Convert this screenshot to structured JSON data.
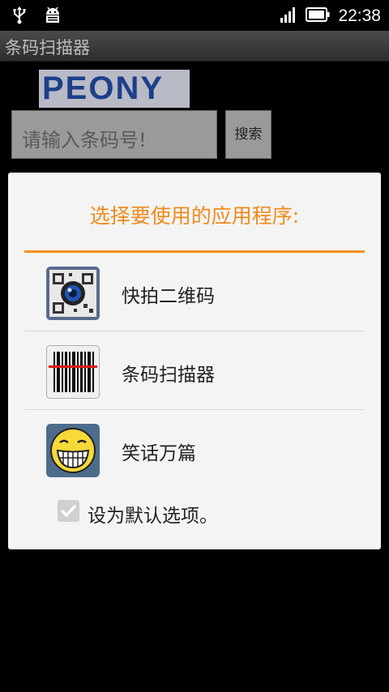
{
  "status_bar": {
    "time": "22:38",
    "icons": [
      "usb-icon",
      "android-debug-icon",
      "signal-icon",
      "battery-icon"
    ]
  },
  "app_title": "条码扫描器",
  "main": {
    "logo_text": "PEONY",
    "search_placeholder": "请输入条码号!",
    "search_button": "搜索"
  },
  "dialog": {
    "title": "选择要使用的应用程序:",
    "apps": [
      {
        "label": "快拍二维码",
        "icon": "qr-camera-icon"
      },
      {
        "label": "条码扫描器",
        "icon": "barcode-icon"
      },
      {
        "label": "笑话万篇",
        "icon": "smiley-icon"
      }
    ],
    "default_checkbox": {
      "label": "设为默认选项。",
      "checked": true
    }
  },
  "colors": {
    "accent": "#f08a1c",
    "dialog_bg": "#f4f4f4"
  }
}
